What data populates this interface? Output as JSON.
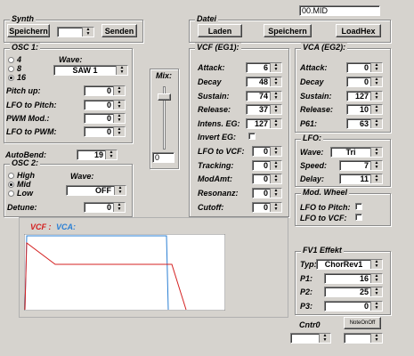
{
  "file_field": "00.MID",
  "synth": {
    "title": "Synth",
    "save_button": "Speichern",
    "send_button": "Senden",
    "slot_value": ""
  },
  "datei": {
    "title": "Datei",
    "load_button": "Laden",
    "save_button": "Speichern",
    "loadhex_button": "LoadHex"
  },
  "osc1": {
    "title": "OSC 1:",
    "octaves": [
      "4",
      "8",
      "16"
    ],
    "selected_octave": "16",
    "wave_label": "Wave:",
    "wave_value": "SAW 1",
    "params": [
      {
        "label": "Pitch up:",
        "value": "0"
      },
      {
        "label": "LFO to Pitch:",
        "value": "0"
      },
      {
        "label": "PWM Mod.:",
        "value": "0"
      },
      {
        "label": "LFO to PWM:",
        "value": "0"
      }
    ]
  },
  "mix": {
    "label": "Mix:",
    "value": "0"
  },
  "autobend": {
    "label": "AutoBend:",
    "value": "19"
  },
  "osc2": {
    "title": "OSC 2:",
    "options": [
      "High",
      "Mid",
      "Low"
    ],
    "selected": "Mid",
    "wave_label": "Wave:",
    "wave_value": "OFF",
    "detune_label": "Detune:",
    "detune_value": "0"
  },
  "vcf": {
    "title": "VCF (EG1):",
    "params": [
      {
        "label": "Attack:",
        "value": "6"
      },
      {
        "label": "Decay",
        "value": "48"
      },
      {
        "label": "Sustain:",
        "value": "74"
      },
      {
        "label": "Release:",
        "value": "37"
      },
      {
        "label": "Intens. EG:",
        "value": "127"
      }
    ],
    "invert_label": "Invert EG:",
    "invert_checked": false,
    "params2": [
      {
        "label": "LFO to VCF:",
        "value": "0"
      },
      {
        "label": "Tracking:",
        "value": "0"
      },
      {
        "label": "ModAmt:",
        "value": "0"
      },
      {
        "label": "Resonanz:",
        "value": "0"
      },
      {
        "label": "Cutoff:",
        "value": "0"
      }
    ]
  },
  "vca": {
    "title": "VCA (EG2):",
    "params": [
      {
        "label": "Attack:",
        "value": "0"
      },
      {
        "label": "Decay",
        "value": "0"
      },
      {
        "label": "Sustain:",
        "value": "127"
      },
      {
        "label": "Release:",
        "value": "10"
      },
      {
        "label": "P61:",
        "value": "63"
      }
    ]
  },
  "lfo": {
    "title": "LFO:",
    "wave_label": "Wave:",
    "wave_value": "Tri",
    "speed_label": "Speed:",
    "speed_value": "7",
    "delay_label": "Delay:",
    "delay_value": "11"
  },
  "modwheel": {
    "title": "Mod. Wheel",
    "items": [
      {
        "label": "LFO to Pitch:",
        "checked": false
      },
      {
        "label": "LFO to VCF:",
        "checked": false
      }
    ]
  },
  "graph": {
    "vcf_label": "VCF :",
    "vca_label": "VCA:",
    "vcf_color": "#d42020",
    "vca_color": "#2a7fd4"
  },
  "fv1": {
    "title": "FV1 Effekt",
    "type_label": "Typ:",
    "type_value": "ChorRev1",
    "params": [
      {
        "label": "P1:",
        "value": "16"
      },
      {
        "label": "P2:",
        "value": "25"
      },
      {
        "label": "P3:",
        "value": "0"
      }
    ]
  },
  "cntr": {
    "label": "Cntr0",
    "note_button": "NoteOnOff",
    "value1": "",
    "value2": ""
  }
}
